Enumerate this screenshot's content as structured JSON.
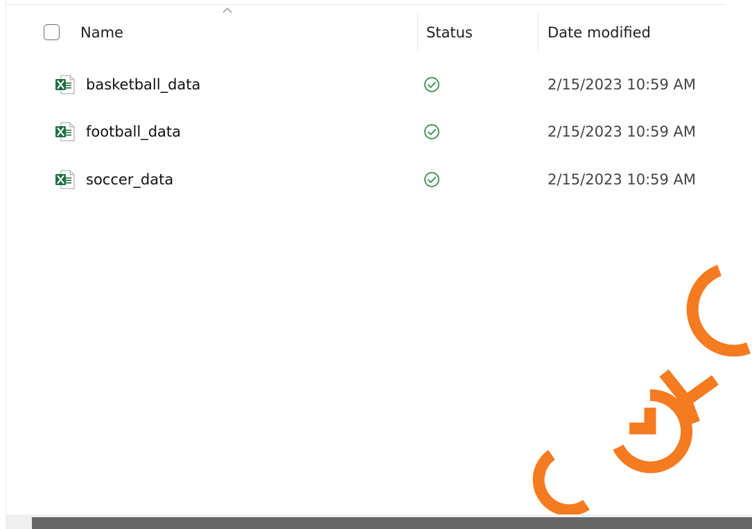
{
  "header": {
    "columns": {
      "name": "Name",
      "status": "Status",
      "date_modified": "Date modified"
    },
    "sort_indicator_icon": "chevron-up-icon"
  },
  "files": [
    {
      "name": "basketball_data",
      "icon": "excel-file-icon",
      "status_icon": "check-circle-icon",
      "date_modified": "2/15/2023 10:59 AM"
    },
    {
      "name": "football_data",
      "icon": "excel-file-icon",
      "status_icon": "check-circle-icon",
      "date_modified": "2/15/2023 10:59 AM"
    },
    {
      "name": "soccer_data",
      "icon": "excel-file-icon",
      "status_icon": "check-circle-icon",
      "date_modified": "2/15/2023 10:59 AM"
    }
  ],
  "colors": {
    "excel_green": "#1d6f42",
    "status_green": "#2e8b3e",
    "watermark_orange": "#f47b20"
  }
}
